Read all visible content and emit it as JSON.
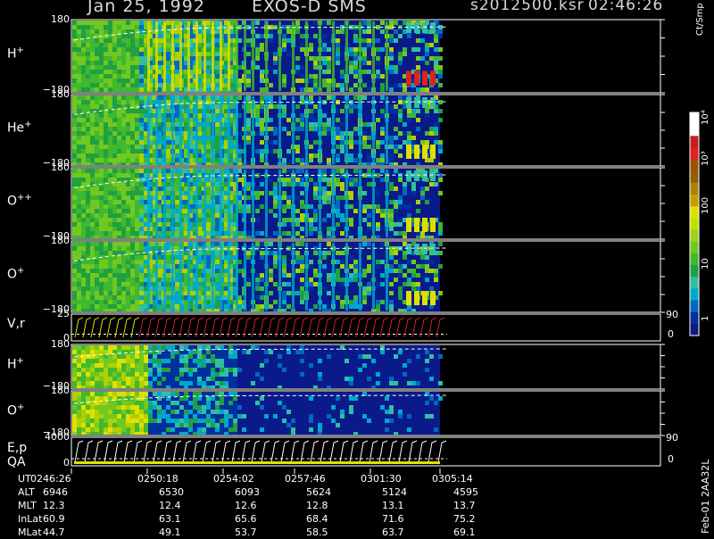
{
  "header": {
    "date": "Jan 25, 1992",
    "mission": "EXOS-D SMS",
    "file": "s2012500.ksr",
    "time": "02:46:26"
  },
  "panels": [
    {
      "id": "p1",
      "label": "H",
      "sup": "+",
      "ymax": "180",
      "ymin": "−180",
      "type": "angle"
    },
    {
      "id": "p2",
      "label": "He",
      "sup": "+",
      "ymax": "180",
      "ymin": "−180",
      "type": "angle"
    },
    {
      "id": "p3",
      "label": "O",
      "sup": "++",
      "ymax": "180",
      "ymin": "−180",
      "type": "angle"
    },
    {
      "id": "p4",
      "label": "O",
      "sup": "+",
      "ymax": "180",
      "ymin": "−180",
      "type": "angle"
    },
    {
      "id": "p5",
      "label": "V,r",
      "sup": "",
      "ymax": "25",
      "ymin": "0",
      "right_top": "90",
      "right_bot": "0",
      "type": "vector"
    },
    {
      "id": "p6",
      "label": "H",
      "sup": "+",
      "ymax": "180",
      "ymin": "−180",
      "type": "angle2"
    },
    {
      "id": "p7",
      "label": "O",
      "sup": "+",
      "ymax": "180",
      "ymin": "−180",
      "type": "angle2"
    },
    {
      "id": "p8",
      "label": "E,p",
      "label2": "QA",
      "sup": "",
      "ymax": "4000",
      "ymin": "0",
      "right_top": "90",
      "right_bot": "0",
      "type": "vector2"
    }
  ],
  "colorbar": {
    "title": "Ct/Smp",
    "ticks": [
      "10⁴",
      "10³",
      "100",
      "10",
      "1"
    ]
  },
  "table": {
    "row_labels": [
      "UT",
      "ALT",
      "MLT",
      "InLat",
      "MLat"
    ],
    "columns": [
      {
        "UT": "0246:26",
        "ALT": "6946",
        "MLT": "12.3",
        "InLat": "60.9",
        "MLat": "44.7"
      },
      {
        "UT": "0250:18",
        "ALT": "6530",
        "MLT": "12.4",
        "InLat": "63.1",
        "MLat": "49.1"
      },
      {
        "UT": "0254:02",
        "ALT": "6093",
        "MLT": "12.6",
        "InLat": "65.6",
        "MLat": "53.7"
      },
      {
        "UT": "0257:46",
        "ALT": "5624",
        "MLT": "12.8",
        "InLat": "68.4",
        "MLat": "58.5"
      },
      {
        "UT": "0301:30",
        "ALT": "5124",
        "MLT": "13.1",
        "InLat": "71.6",
        "MLat": "63.7"
      },
      {
        "UT": "0305:14",
        "ALT": "4595",
        "MLT": "13.7",
        "InLat": "75.2",
        "MLat": "69.1"
      }
    ]
  },
  "footer_code": "Feb-01 2AA32L",
  "chart_data": {
    "type": "heatmap",
    "x": [
      "0246:26",
      "0250:18",
      "0254:02",
      "0257:46",
      "0301:30",
      "0305:14"
    ],
    "ylim": [
      -180,
      180
    ],
    "colorscale": [
      "#1a0070",
      "#00a0d0",
      "#40c040",
      "#e0e000",
      "#e02020",
      "#ffffff"
    ]
  }
}
